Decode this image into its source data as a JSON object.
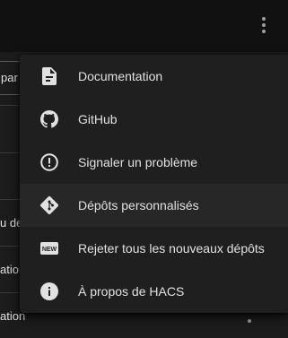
{
  "background": {
    "search_fragment": "par É",
    "row_fragments": [
      "u de",
      "ation",
      "ation"
    ]
  },
  "menu": {
    "items": [
      {
        "label": "Documentation",
        "icon": "file-document-icon"
      },
      {
        "label": "GitHub",
        "icon": "github-icon"
      },
      {
        "label": "Signaler un problème",
        "icon": "alert-circle-icon"
      },
      {
        "label": "Dépôts personnalisés",
        "icon": "git-icon"
      },
      {
        "label": "Rejeter tous les nouveaux dépôts",
        "icon": "new-box-icon"
      },
      {
        "label": "À propos de HACS",
        "icon": "information-icon"
      }
    ]
  },
  "colors": {
    "page_bg": "#111111",
    "menu_bg": "#1f1f1f",
    "icon": "#e1e1e1",
    "text": "#e1e1e1"
  }
}
